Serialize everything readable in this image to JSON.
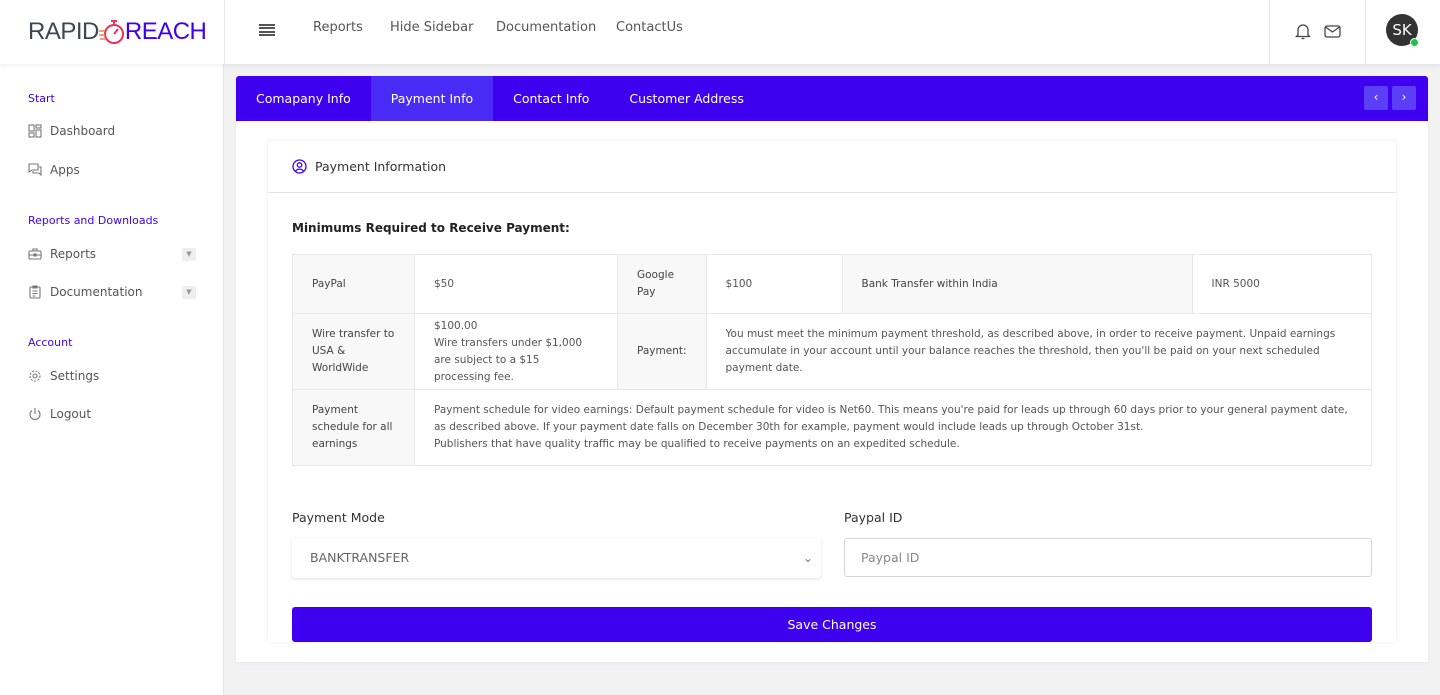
{
  "brand": {
    "part1": "RAPID",
    "part2": "REACH",
    "accent": "#3f00f0",
    "logo_color": "#f0305a"
  },
  "topnav": [
    "Reports",
    "Hide Sidebar",
    "Documentation",
    "ContactUs"
  ],
  "user": {
    "initials": "SK",
    "status": "online"
  },
  "sidebar": {
    "sections": [
      {
        "title": "Start",
        "items": [
          {
            "label": "Dashboard",
            "icon": "grid-icon"
          },
          {
            "label": "Apps",
            "icon": "chat-icon"
          }
        ]
      },
      {
        "title": "Reports and Downloads",
        "items": [
          {
            "label": "Reports",
            "icon": "briefcase-icon",
            "dropdown": true
          },
          {
            "label": "Documentation",
            "icon": "clipboard-icon",
            "dropdown": true
          }
        ]
      },
      {
        "title": "Account",
        "items": [
          {
            "label": "Settings",
            "icon": "gear-icon"
          },
          {
            "label": "Logout",
            "icon": "power-icon"
          }
        ]
      }
    ]
  },
  "tabs": [
    {
      "label": "Comapany Info"
    },
    {
      "label": "Payment Info",
      "active": true
    },
    {
      "label": "Contact Info"
    },
    {
      "label": "Customer Address"
    }
  ],
  "card": {
    "title": "Payment Information",
    "heading": "Minimums Required to Receive Payment:"
  },
  "table": {
    "paypal_label": "PayPal",
    "paypal_value": "$50",
    "gpay_label": "Google Pay",
    "gpay_value": "$100",
    "bank_label": "Bank Transfer within India",
    "bank_value": "INR 5000",
    "wire_label": "Wire transfer to USA & WorldWide",
    "wire_value": "$100.00",
    "wire_note": "Wire transfers under $1,000 are subject to a $15 processing fee.",
    "payment_label": "Payment:",
    "payment_text": "You must meet the minimum payment threshold, as described above, in order to receive payment. Unpaid earnings accumulate in your account until your balance reaches the threshold, then you'll be paid on your next scheduled payment date.",
    "schedule_label": "Payment schedule for all earnings",
    "schedule_line1": "Payment schedule for video earnings: Default payment schedule for video is Net60. This means you're paid for leads up through 60 days prior to your general payment date, as described above. If your payment date falls on December 30th for example, payment would include leads up through October 31st.",
    "schedule_line2": "Publishers that have quality traffic may be qualified to receive payments on an expedited schedule."
  },
  "form": {
    "mode_label": "Payment Mode",
    "mode_value": "BANKTRANSFER",
    "paypal_label": "Paypal ID",
    "paypal_placeholder": "Paypal ID",
    "paypal_value": "",
    "save_label": "Save Changes"
  }
}
